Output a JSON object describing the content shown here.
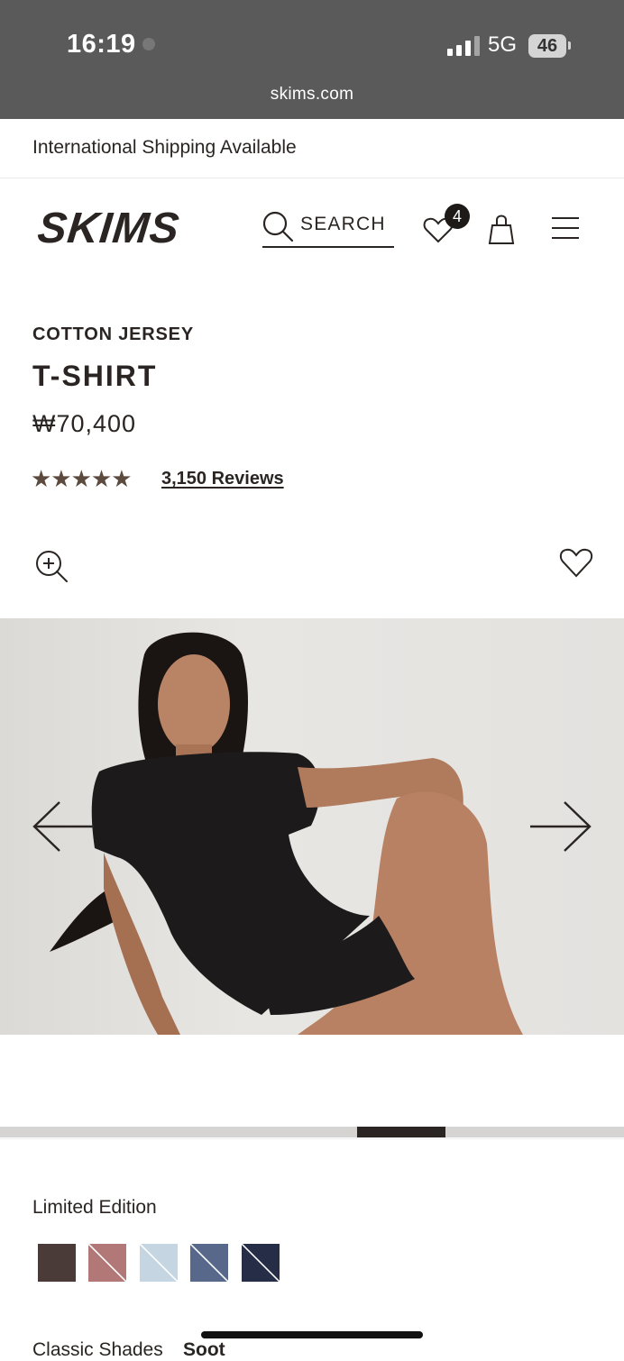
{
  "status_bar": {
    "time": "16:19",
    "network": "5G",
    "battery": "46",
    "url": "skims.com"
  },
  "banner": {
    "text": "International Shipping Available"
  },
  "header": {
    "logo": "SKIMS",
    "search_label": "SEARCH",
    "wishlist_count": "4"
  },
  "product": {
    "category": "COTTON JERSEY",
    "title": "T-SHIRT",
    "price": "₩70,400",
    "rating_stars": "★★★★★",
    "rating": 5,
    "reviews_label": "3,150 Reviews"
  },
  "carousel": {
    "progress": {
      "start": 0.572,
      "end": 0.714
    }
  },
  "variants": {
    "limited_label": "Limited Edition",
    "swatches": [
      {
        "name": "dark-brown",
        "color": "#4a3a38",
        "sold_out": false
      },
      {
        "name": "rose",
        "color": "#b27877",
        "sold_out": true
      },
      {
        "name": "light-blue-print",
        "color": "#c5d6e2",
        "sold_out": true
      },
      {
        "name": "slate-blue",
        "color": "#58688a",
        "sold_out": true
      },
      {
        "name": "navy",
        "color": "#262d46",
        "sold_out": true
      }
    ],
    "classic_label": "Classic Shades",
    "classic_value": "Soot"
  },
  "colors": {
    "text": "#2a2522",
    "star": "#5b4a3d",
    "status_bar": "#5a5a5a"
  }
}
